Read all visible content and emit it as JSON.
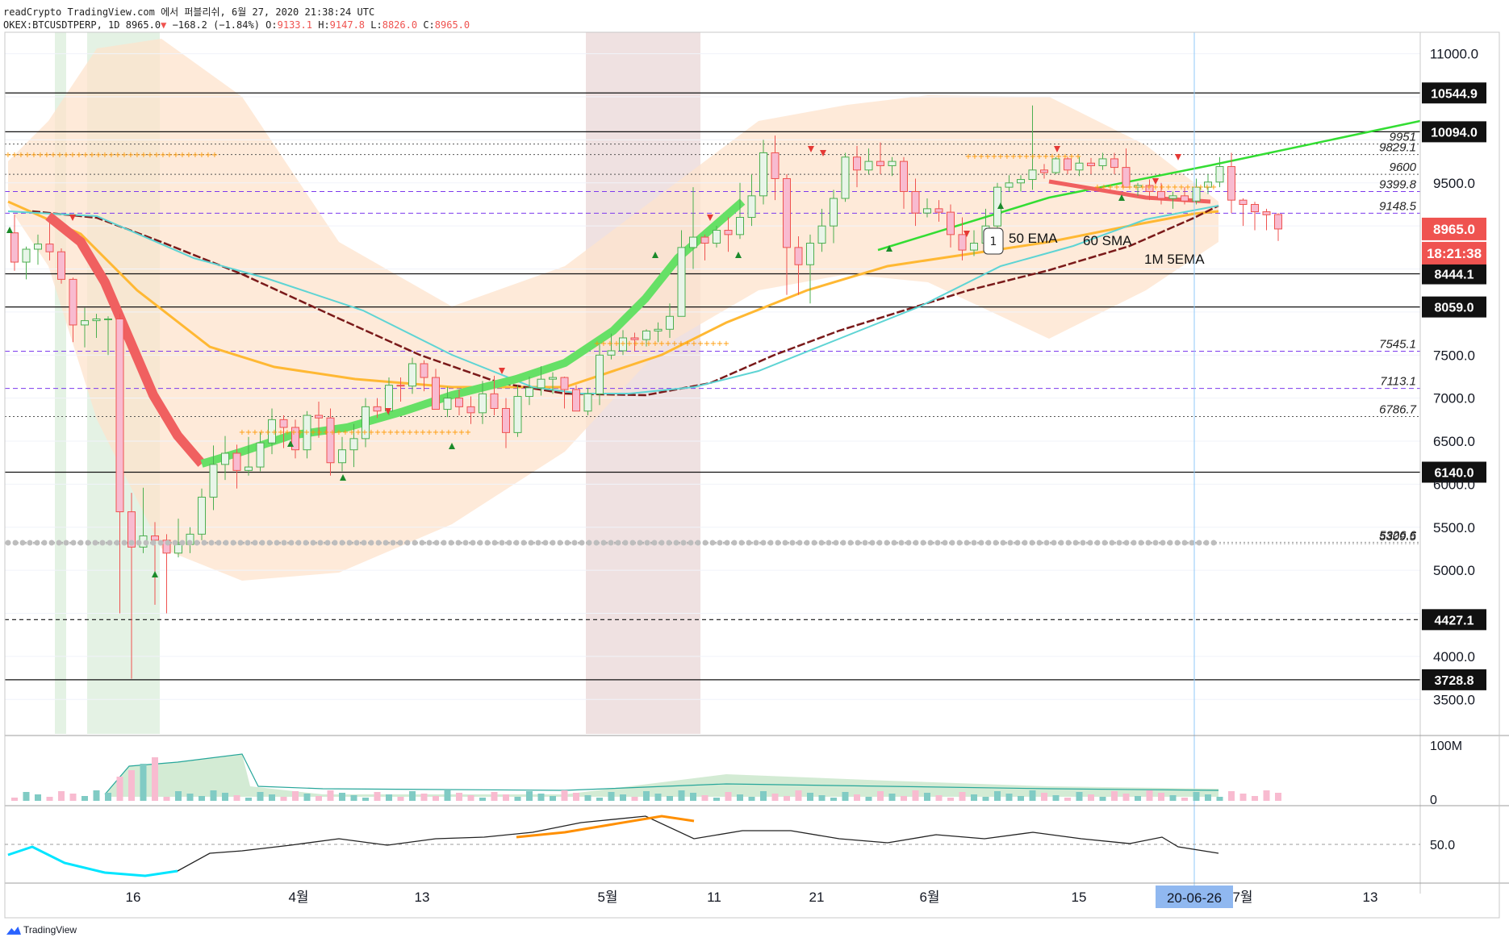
{
  "header": {
    "line1": "readCrypto TradingView.com 에서 퍼블리쉬, 6월 27, 2020 21:38:24 UTC",
    "symbol": "OKEX:BTCUSDTPERP, 1D",
    "last": "8965.0",
    "arrow": "▼",
    "change": "−168.2 (−1.84%)",
    "o_label": "O:",
    "o_value": "9133.1",
    "h_label": "H:",
    "h_value": "9147.8",
    "l_label": "L:",
    "l_value": "8826.0",
    "c_label": "C:",
    "c_value": "8965.0"
  },
  "brand": "TradingView",
  "colors": {
    "bull": "#26a69a",
    "bear": "#ef5350",
    "bullCandle": "#f4a582",
    "bearCandle": "#f4a582",
    "ema50": "#ffb833",
    "sma60": "#7a1a1a",
    "ribbonUp": "#66e066",
    "ribbonDown": "#f06060",
    "band": "#fde3cc",
    "ema5_1m": "#5ed4d4",
    "trend": "#33dd33",
    "accent": "#2962ff"
  },
  "chart_data": {
    "type": "candlestick",
    "title": "",
    "ylim": [
      3100,
      11250
    ],
    "y_ticks": [
      "11000.0",
      "10500.0",
      "10000.0",
      "9500.0",
      "9000.0",
      "8500.0",
      "8000.0",
      "7500.0",
      "7000.0",
      "6500.0",
      "6000.0",
      "5500.0",
      "5000.0",
      "4500.0",
      "4000.0",
      "3500.0"
    ],
    "x_ticks": [
      "16",
      "4월",
      "13",
      "5월",
      "11",
      "21",
      "6월",
      "15",
      "7월",
      "13"
    ],
    "crosshair_date": "20-06-26",
    "last_price": "8965.0",
    "countdown": "18:21:38",
    "horizontal_levels": [
      {
        "price": 10544.9,
        "label": "10544.9"
      },
      {
        "price": 10094.0,
        "label": "10094.0"
      },
      {
        "price": 8444.1,
        "label": "8444.1"
      },
      {
        "price": 8059.0,
        "label": "8059.0"
      },
      {
        "price": 6140.0,
        "label": "6140.0"
      },
      {
        "price": 4427.1,
        "label": "4427.1",
        "style": "dashed"
      },
      {
        "price": 3728.8,
        "label": "3728.8"
      }
    ],
    "dotted_levels": [
      {
        "price": 9951,
        "label": "9951"
      },
      {
        "price": 9829.1,
        "label": "9829.1"
      },
      {
        "price": 9600,
        "label": "9600"
      },
      {
        "price": 9399.8,
        "label": "9399.8"
      },
      {
        "price": 9148.5,
        "label": "9148.5"
      },
      {
        "price": 7545.1,
        "label": "7545.1"
      },
      {
        "price": 7113.1,
        "label": "7113.1"
      },
      {
        "price": 6786.7,
        "label": "6786.7"
      },
      {
        "price": 5326.6,
        "label": "5326.6"
      },
      {
        "price": 5309.5,
        "label": "5309.5"
      }
    ],
    "annotations": [
      "1",
      "50 EMA",
      "60 SMA",
      "1M 5EMA"
    ],
    "volume_scale": [
      "100M",
      "0"
    ],
    "rsi_scale": [
      "50.0"
    ],
    "candles": [
      [
        8920,
        9130,
        8480,
        8580
      ],
      [
        8580,
        8760,
        8380,
        8730
      ],
      [
        8730,
        8900,
        8550,
        8790
      ],
      [
        8790,
        9040,
        8600,
        8700
      ],
      [
        8700,
        8740,
        8330,
        8380
      ],
      [
        8380,
        8400,
        7650,
        7850
      ],
      [
        7850,
        8050,
        7590,
        7900
      ],
      [
        7900,
        7980,
        7700,
        7920
      ],
      [
        7920,
        7950,
        7500,
        7920
      ],
      [
        7920,
        7980,
        4500,
        5680
      ],
      [
        5680,
        5900,
        3740,
        5270
      ],
      [
        5270,
        5960,
        5200,
        5400
      ],
      [
        5400,
        5560,
        4600,
        5350
      ],
      [
        5350,
        5420,
        4500,
        5200
      ],
      [
        5200,
        5600,
        5150,
        5300
      ],
      [
        5300,
        5500,
        5200,
        5420
      ],
      [
        5420,
        5950,
        5350,
        5850
      ],
      [
        5850,
        6450,
        5700,
        6230
      ],
      [
        6230,
        6560,
        6050,
        6360
      ],
      [
        6360,
        6460,
        5950,
        6160
      ],
      [
        6160,
        6550,
        6100,
        6200
      ],
      [
        6200,
        6600,
        6150,
        6480
      ],
      [
        6480,
        6880,
        6350,
        6750
      ],
      [
        6750,
        6800,
        6420,
        6660
      ],
      [
        6660,
        6750,
        6300,
        6400
      ],
      [
        6400,
        6850,
        6300,
        6800
      ],
      [
        6800,
        6960,
        6540,
        6770
      ],
      [
        6770,
        6880,
        6100,
        6250
      ],
      [
        6250,
        6550,
        6150,
        6400
      ],
      [
        6400,
        6700,
        6200,
        6530
      ],
      [
        6530,
        7000,
        6430,
        6900
      ],
      [
        6900,
        7000,
        6770,
        6850
      ],
      [
        6850,
        7240,
        6800,
        7150
      ],
      [
        7150,
        7240,
        6960,
        7140
      ],
      [
        7140,
        7470,
        7050,
        7400
      ],
      [
        7400,
        7440,
        7080,
        7240
      ],
      [
        7240,
        7340,
        6900,
        6870
      ],
      [
        6870,
        7130,
        6780,
        7000
      ],
      [
        7000,
        7100,
        6800,
        6900
      ],
      [
        6900,
        7020,
        6700,
        6830
      ],
      [
        6830,
        7200,
        6700,
        7050
      ],
      [
        7050,
        7260,
        6800,
        6880
      ],
      [
        6880,
        7000,
        6420,
        6600
      ],
      [
        6600,
        7150,
        6550,
        7020
      ],
      [
        7020,
        7250,
        6920,
        7120
      ],
      [
        7120,
        7370,
        7030,
        7220
      ],
      [
        7220,
        7300,
        7050,
        7240
      ],
      [
        7240,
        7250,
        6880,
        7100
      ],
      [
        7100,
        7150,
        6910,
        6850
      ],
      [
        6850,
        7120,
        6800,
        7050
      ],
      [
        7050,
        7620,
        6920,
        7500
      ],
      [
        7500,
        7750,
        7450,
        7550
      ],
      [
        7550,
        7790,
        7500,
        7700
      ],
      [
        7700,
        7760,
        7550,
        7680
      ],
      [
        7680,
        7800,
        7600,
        7780
      ],
      [
        7780,
        7880,
        7650,
        7800
      ],
      [
        7800,
        8100,
        7700,
        7950
      ],
      [
        7950,
        8950,
        7950,
        8750
      ],
      [
        8750,
        9450,
        8500,
        8870
      ],
      [
        8870,
        8900,
        8600,
        8800
      ],
      [
        8800,
        9000,
        8750,
        8950
      ],
      [
        8950,
        9100,
        8700,
        8900
      ],
      [
        8900,
        9500,
        8850,
        9100
      ],
      [
        9100,
        9600,
        9000,
        9350
      ],
      [
        9350,
        10000,
        9250,
        9850
      ],
      [
        9850,
        10050,
        9300,
        9550
      ],
      [
        9550,
        9600,
        8200,
        8750
      ],
      [
        8750,
        8880,
        8200,
        8550
      ],
      [
        8550,
        8900,
        8100,
        8800
      ],
      [
        8800,
        9200,
        8700,
        9000
      ],
      [
        9000,
        9420,
        8800,
        9320
      ],
      [
        9320,
        9850,
        9280,
        9800
      ],
      [
        9800,
        9930,
        9450,
        9650
      ],
      [
        9650,
        9900,
        9600,
        9750
      ],
      [
        9750,
        9970,
        9600,
        9700
      ],
      [
        9700,
        9800,
        9580,
        9750
      ],
      [
        9750,
        9800,
        9200,
        9400
      ],
      [
        9400,
        9550,
        9000,
        9150
      ],
      [
        9150,
        9320,
        9100,
        9200
      ],
      [
        9200,
        9300,
        9050,
        9160
      ],
      [
        9160,
        9250,
        8750,
        8900
      ],
      [
        8900,
        9100,
        8600,
        8720
      ],
      [
        8720,
        8950,
        8650,
        8800
      ],
      [
        8800,
        9200,
        8750,
        9000
      ],
      [
        9000,
        9500,
        8980,
        9450
      ],
      [
        9450,
        9590,
        9400,
        9500
      ],
      [
        9500,
        9590,
        9400,
        9540
      ],
      [
        9540,
        10400,
        9420,
        9650
      ],
      [
        9650,
        9720,
        9550,
        9620
      ],
      [
        9620,
        9800,
        9600,
        9780
      ],
      [
        9780,
        9800,
        9600,
        9650
      ],
      [
        9650,
        9800,
        9580,
        9730
      ],
      [
        9730,
        9790,
        9600,
        9700
      ],
      [
        9700,
        9850,
        9650,
        9780
      ],
      [
        9780,
        9850,
        9600,
        9680
      ],
      [
        9680,
        9900,
        9600,
        9450
      ],
      [
        9450,
        9500,
        9350,
        9470
      ],
      [
        9470,
        9540,
        9300,
        9400
      ],
      [
        9400,
        9500,
        9250,
        9320
      ],
      [
        9320,
        9400,
        9200,
        9350
      ],
      [
        9350,
        9450,
        9250,
        9290
      ],
      [
        9290,
        9550,
        9250,
        9450
      ],
      [
        9450,
        9600,
        9370,
        9510
      ],
      [
        9510,
        9800,
        9450,
        9690
      ],
      [
        9690,
        9850,
        9150,
        9300
      ],
      [
        9300,
        9320,
        9000,
        9250
      ],
      [
        9250,
        9280,
        8950,
        9165
      ],
      [
        9165,
        9200,
        8950,
        9130
      ],
      [
        9133.1,
        9147.8,
        8826,
        8965
      ]
    ],
    "series": [
      {
        "name": "50 EMA"
      },
      {
        "name": "60 SMA"
      },
      {
        "name": "1M 5EMA"
      }
    ]
  }
}
